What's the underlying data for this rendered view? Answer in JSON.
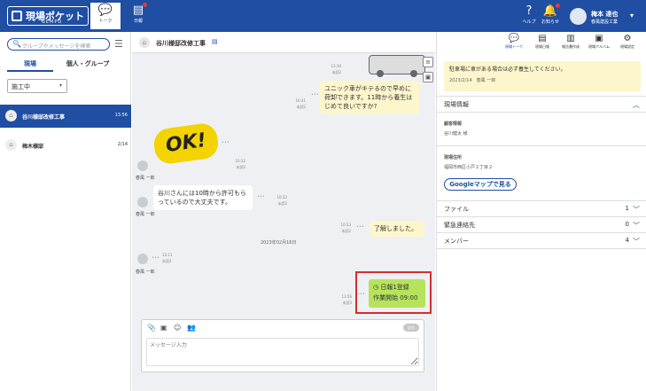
{
  "header": {
    "app_name": "現場ポケット",
    "app_sub": "GEMPO",
    "nav_talk": "トーク",
    "nav_daily": "日報",
    "help": "ヘルプ",
    "notice": "お知らせ",
    "user_name": "梅本 達也",
    "user_company": "春風建設工業",
    "accent": "#1f4ea3"
  },
  "sidebar": {
    "search_placeholder": "グループやメッセージを検索",
    "tabs": [
      "現場",
      "個人・グループ"
    ],
    "status_select": "施工中",
    "projects": [
      {
        "name": "谷川様邸改修工事",
        "time": "13:56",
        "active": true
      },
      {
        "name": "梅木様邸",
        "time": "2/14",
        "active": false
      }
    ]
  },
  "chat": {
    "title": "谷川様邸改修工事",
    "messages": [
      {
        "time": "13:30",
        "read": "未読2"
      },
      {
        "time": "10:31",
        "read": "未読2",
        "text": "ユニック車がキテるので早めに荷卸できます。11時から養生はじめて良いですか?"
      },
      {
        "time": "10:32",
        "read": "未読2",
        "sender": "春風 一郎",
        "sticker": "OK!"
      },
      {
        "time": "10:32",
        "read": "未読2",
        "sender": "春風 一郎",
        "text": "谷川さんには10時から許可もらっているので大丈夫です。"
      },
      {
        "time": "10:33",
        "read": "未読2",
        "text": "了解しました。"
      },
      {
        "time": "13:11",
        "read": "未読2",
        "sender": "春風 一郎"
      },
      {
        "time": "13:56",
        "read": "未読3",
        "report_title": "日報1登録",
        "report_body": "作業開始 09:00"
      }
    ],
    "date_separator": "2023年02月16日",
    "compose_placeholder": "メッセージ入力",
    "send_label": "送信"
  },
  "right_panel": {
    "tabs": [
      "現場トーク",
      "現場日報",
      "報告書作成",
      "現場アルバム",
      "現場設定"
    ],
    "notice_text": "駐車場に車がある場合は必ず養生してください。",
    "notice_date": "2023/2/14",
    "notice_author": "春風 一郎",
    "section_info": "現場情報",
    "customer_label": "顧客情報",
    "customer_value": "谷川健太 様",
    "address_label": "現場住所",
    "address_value": "福岡市西区小戸２丁目２",
    "maps_button": "Googleマップで見る",
    "files_label": "ファイル",
    "files_count": "1",
    "emergency_label": "緊急連絡先",
    "emergency_count": "0",
    "members_label": "メンバー",
    "members_count": "4"
  }
}
